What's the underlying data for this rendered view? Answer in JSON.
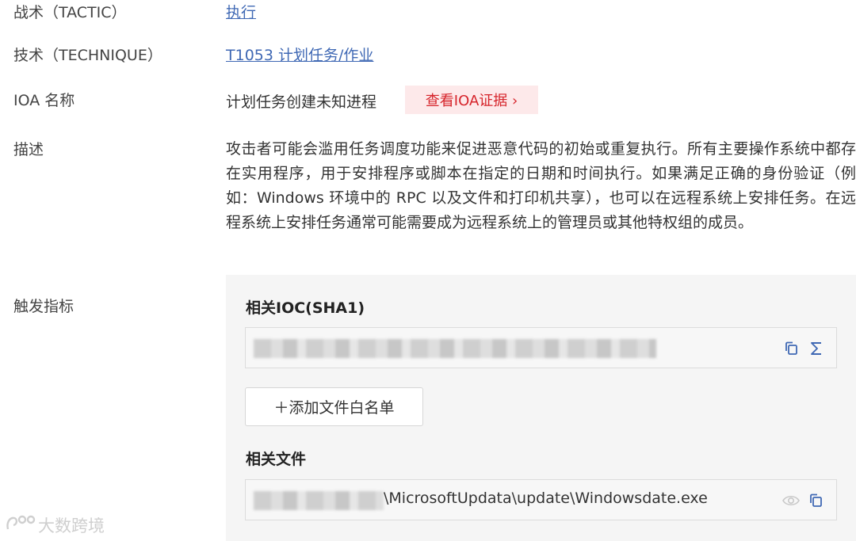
{
  "rows": {
    "tactic": {
      "label": "战术（TACTIC）",
      "value": "执行"
    },
    "technique": {
      "label": "技术（TECHNIQUE）",
      "value": "T1053 计划任务/作业"
    },
    "ioa_name": {
      "label": "IOA 名称",
      "value": "计划任务创建未知进程",
      "evidence_button": "查看IOA证据 ›"
    },
    "description": {
      "label": "描述",
      "text": "攻击者可能会滥用任务调度功能来促进恶意代码的初始或重复执行。所有主要操作系统中都存在实用程序，用于安排程序或脚本在指定的日期和时间执行。如果满足正确的身份验证（例如：Windows 环境中的 RPC 以及文件和打印机共享），也可以在远程系统上安排任务。在远程系统上安排任务通常可能需要成为远程系统上的管理员或其他特权组的成员。"
    },
    "indicators": {
      "label": "触发指标"
    }
  },
  "indicators_panel": {
    "ioc_title": "相关IOC(SHA1)",
    "add_whitelist_button": "＋添加文件白名单",
    "files_title": "相关文件",
    "file_path_visible": "\\MicrosoftUpdata\\update\\Windowsdate.exe"
  },
  "icons": {
    "ioc_copy": "copy-icon",
    "ioc_sum": "sigma-icon",
    "file_view": "eye-icon",
    "file_copy": "copy-icon"
  },
  "watermark": {
    "text": "大数跨境"
  },
  "colors": {
    "link": "#3f68b4",
    "evidence_bg": "#fde9ea",
    "evidence_text": "#d6242b",
    "icon_blue": "#3f68b4",
    "panel_bg": "#f5f5f5"
  }
}
